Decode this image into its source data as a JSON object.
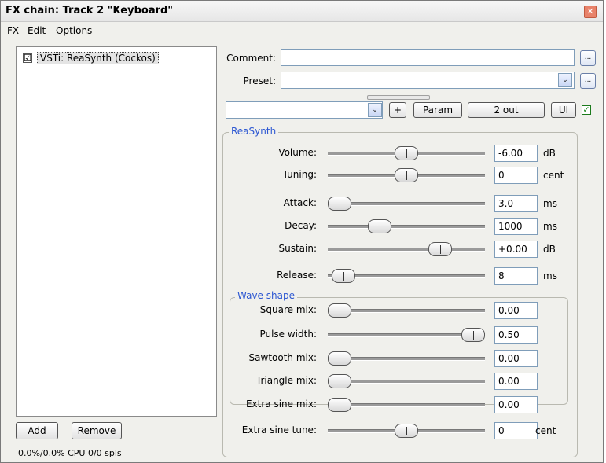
{
  "window": {
    "title": "FX chain: Track 2 \"Keyboard\"",
    "close": "✕"
  },
  "menu": [
    "FX",
    "Edit",
    "Options"
  ],
  "fx_list": [
    {
      "label": "VSTi: ReaSynth (Cockos)",
      "checked": "☑"
    }
  ],
  "left_buttons": {
    "add": "Add",
    "remove": "Remove"
  },
  "status": "0.0%/0.0% CPU 0/0 spls",
  "comment": {
    "label": "Comment:",
    "value": "",
    "ellipsis": "..."
  },
  "preset": {
    "label": "Preset:",
    "value": "",
    "ellipsis": "...",
    "dropdown": "⌄"
  },
  "toolbar": {
    "dropdown": "⌄",
    "plus": "+",
    "param": "Param",
    "out": "2 out",
    "ui": "UI",
    "ui_checked": "✓"
  },
  "reasynth": {
    "title": "ReaSynth",
    "params": [
      {
        "label": "Volume:",
        "value": "-6.00",
        "unit": "dB",
        "level": 0.5
      },
      {
        "label": "Tuning:",
        "value": "0",
        "unit": "cent",
        "level": 0.5
      },
      {
        "label": "Attack:",
        "value": "3.0",
        "unit": "ms",
        "level": 0.0
      },
      {
        "label": "Decay:",
        "value": "1000",
        "unit": "ms",
        "level": 0.3
      },
      {
        "label": "Sustain:",
        "value": "+0.00",
        "unit": "dB",
        "level": 0.75
      },
      {
        "label": "Release:",
        "value": "8",
        "unit": "ms",
        "level": 0.03
      }
    ]
  },
  "wave": {
    "title": "Wave shape",
    "params": [
      {
        "label": "Square mix:",
        "value": "0.00",
        "unit": "",
        "level": 0.0
      },
      {
        "label": "Pulse width:",
        "value": "0.50",
        "unit": "",
        "level": 1.0
      },
      {
        "label": "Sawtooth mix:",
        "value": "0.00",
        "unit": "",
        "level": 0.0
      },
      {
        "label": "Triangle mix:",
        "value": "0.00",
        "unit": "",
        "level": 0.0
      },
      {
        "label": "Extra sine mix:",
        "value": "0.00",
        "unit": "",
        "level": 0.0
      },
      {
        "label": "Extra sine tune:",
        "value": "0",
        "unit": "cent",
        "level": 0.5
      }
    ]
  }
}
